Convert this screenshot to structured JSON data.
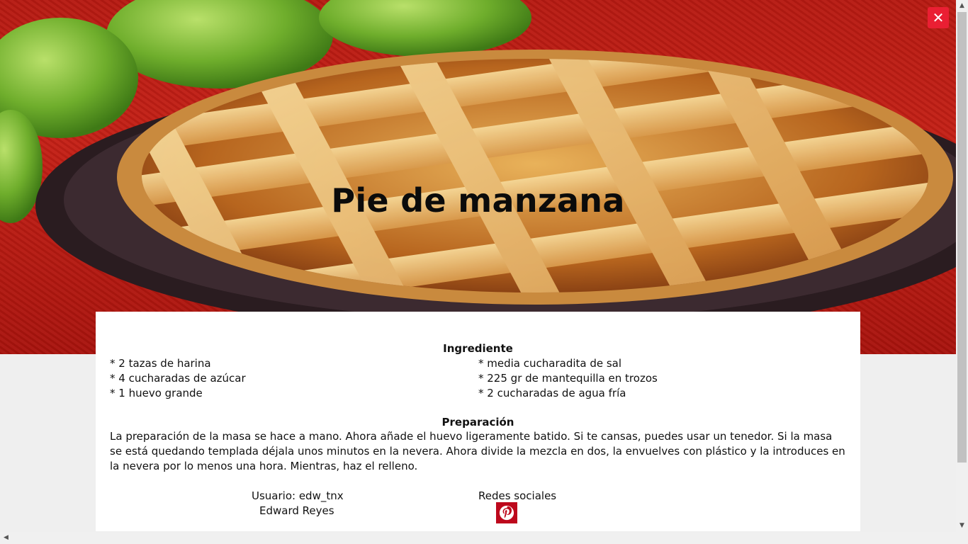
{
  "hero": {
    "title": "Pie de manzana",
    "close_icon": "close-icon"
  },
  "ingredients": {
    "title": "Ingrediente",
    "left": [
      "* 2 tazas de harina",
      "* 4 cucharadas de azúcar",
      "* 1 huevo grande"
    ],
    "right": [
      "* media cucharadita de sal",
      "* 225 gr de mantequilla en trozos",
      "* 2 cucharadas de agua fría"
    ]
  },
  "preparation": {
    "title": "Preparación",
    "text": "La preparación de la masa se hace a mano. Ahora añade el huevo ligeramente batido. Si te cansas, puedes usar un tenedor. Si la masa se está quedando templada déjala unos minutos en la nevera. Ahora divide la mezcla en dos, la envuelves con plástico y la introduces en la nevera por lo menos una hora. Mientras, haz el relleno."
  },
  "author": {
    "user_label": "Usuario: edw_tnx",
    "name": "Edward Reyes"
  },
  "social": {
    "title": "Redes sociales",
    "icon": "pinterest-icon"
  },
  "colors": {
    "close_bg": "#ea1f33",
    "pinterest": "#bd081c",
    "background": "#efefef"
  }
}
